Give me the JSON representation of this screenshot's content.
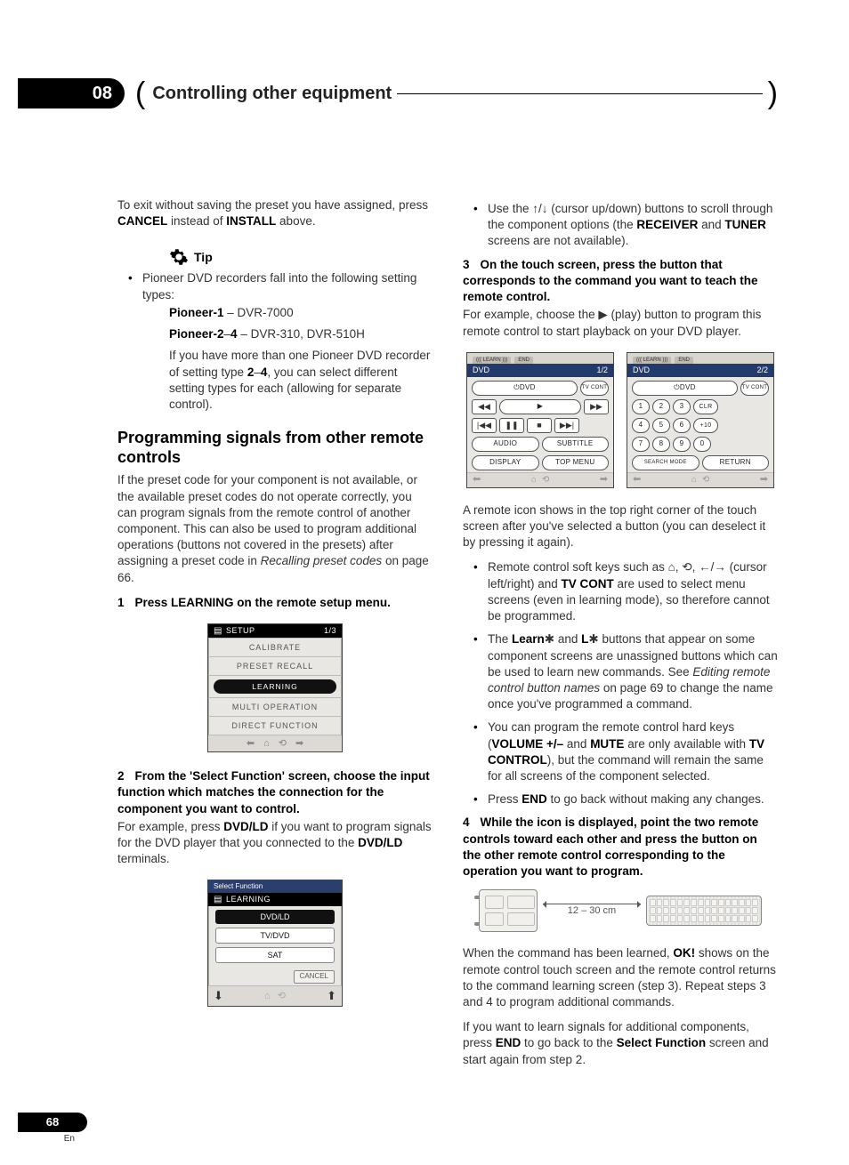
{
  "header": {
    "chapter_number": "08",
    "chapter_title": "Controlling other equipment"
  },
  "left": {
    "intro1a": "To exit without saving the preset you have assigned, press ",
    "intro1_cancel": "CANCEL",
    "intro1b": " instead of ",
    "intro1_install": "INSTALL",
    "intro1c": " above.",
    "tip_label": "Tip",
    "tip1": "Pioneer DVD recorders fall into the following setting types:",
    "tip_p1a": "Pioneer-1",
    "tip_p1b": " – DVR-7000",
    "tip_p2a": "Pioneer-2",
    "tip_p2b": "–",
    "tip_p2c": "4",
    "tip_p2d": " – DVR-310, DVR-510H",
    "tip2a": "If you have more than one Pioneer DVD recorder of setting type ",
    "tip2b": "2",
    "tip2c": "–",
    "tip2d": "4",
    "tip2e": ", you can select different setting types for each (allowing for separate control).",
    "h2": "Programming signals from other remote controls",
    "para1a": "If the preset code for your component is not available, or the available preset codes do not operate correctly, you can program signals from the remote control of another component. This can also be used to program additional operations (buttons not covered in the presets) after assigning a preset code in ",
    "para1b": "Recalling preset codes",
    "para1c": " on page 66.",
    "step1_num": "1",
    "step1": "Press LEARNING on the remote setup menu.",
    "screen1": {
      "title": "SETUP",
      "page": "1/3",
      "items": [
        "CALIBRATE",
        "PRESET RECALL",
        "LEARNING",
        "MULTI OPERATION",
        "DIRECT FUNCTION"
      ]
    },
    "step2_num": "2",
    "step2": "From the 'Select Function' screen, choose the input function which matches the connection for the component you want to control.",
    "step2_body_a": "For example, press ",
    "step2_body_b": "DVD/LD",
    "step2_body_c": " if you want to program signals for the DVD player that you connected to the ",
    "step2_body_d": "DVD/LD",
    "step2_body_e": " terminals.",
    "screen2": {
      "title_small": "Select Function",
      "title": "LEARNING",
      "items": [
        "DVD/LD",
        "TV/DVD",
        "SAT"
      ],
      "cancel": "CANCEL"
    }
  },
  "right": {
    "bullet_use_a": "Use the ",
    "bullet_use_b": " (cursor up/down) buttons to scroll through the component options (the ",
    "bullet_use_c": "RECEIVER",
    "bullet_use_d": " and ",
    "bullet_use_e": "TUNER",
    "bullet_use_f": " screens are not available).",
    "step3_num": "3",
    "step3": "On the touch screen, press the button that corresponds to the command you want to teach the remote control.",
    "step3_body_a": "For example, choose the ",
    "step3_body_b": " (play) button to program this remote control to start playback on your DVD player.",
    "dvd_tabs": {
      "learn": "((( LEARN )))",
      "end": "END"
    },
    "dvd1": {
      "mode": "DVD",
      "page": "1/2",
      "btn_dvd": "DVD",
      "tv_cont": "TV CONT",
      "audio": "AUDIO",
      "subtitle": "SUBTITLE",
      "display": "DISPLAY",
      "topmenu": "TOP MENU"
    },
    "dvd2": {
      "mode": "DVD",
      "page": "2/2",
      "btn_dvd": "DVD",
      "tv_cont": "TV CONT",
      "nums": [
        "1",
        "2",
        "3",
        "CLR",
        "4",
        "5",
        "6",
        "+10",
        "7",
        "8",
        "9",
        "0"
      ],
      "search": "SEARCH MODE",
      "return": "RETURN"
    },
    "para_after_dvd": "A remote icon shows in the top right corner of the touch screen after you've selected a button (you can deselect it by pressing it again).",
    "b1a": "Remote control soft keys such as ",
    "b1b": " (cursor left/right) and ",
    "b1c": "TV CONT",
    "b1d": " are used to select menu screens (even in learning mode), so therefore cannot be programmed.",
    "b2a": "The ",
    "b2b": "Learn",
    "b2c": " and ",
    "b2d": "L",
    "b2e": " buttons that appear on some component screens are unassigned buttons which can be used to learn new commands. See ",
    "b2f": "Editing remote control button names",
    "b2g": " on page 69 to change the name once you've programmed a command.",
    "b3a": "You can program the remote control hard keys (",
    "b3b": "VOLUME +/–",
    "b3c": " and ",
    "b3d": "MUTE",
    "b3e": " are only available with ",
    "b3f": "TV CONTROL",
    "b3g": "), but the command will remain the same for all screens of the component selected.",
    "b4a": "Press ",
    "b4b": "END",
    "b4c": " to go back without making any changes.",
    "step4_num": "4",
    "step4": "While the icon is displayed, point the two remote controls toward each other and press the button on the other remote control corresponding to the operation you want to program.",
    "dist_label": "12 – 30 cm",
    "para_ok_a": "When the command has been learned, ",
    "para_ok_b": "OK!",
    "para_ok_c": " shows on the remote control touch screen and the remote control returns to the command learning screen (step 3). Repeat steps 3 and 4 to program additional commands.",
    "para_end_a": "If you want to learn signals for additional components, press ",
    "para_end_b": "END",
    "para_end_c": " to go back to the ",
    "para_end_d": "Select Function",
    "para_end_e": " screen and start again from step 2."
  },
  "footer": {
    "page": "68",
    "lang": "En"
  }
}
